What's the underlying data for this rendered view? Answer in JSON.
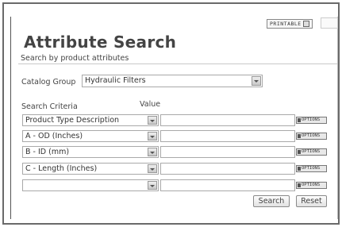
{
  "header": {
    "printable_label": "PRINTABLE"
  },
  "page": {
    "title": "Attribute Search",
    "subtitle": "Search by product attributes"
  },
  "catalog_group": {
    "label": "Catalog Group",
    "selected": "Hydraulic Filters"
  },
  "criteria": {
    "col_criteria": "Search Criteria",
    "col_value": "Value",
    "rows": [
      {
        "criteria": "Product Type Description",
        "value": "",
        "options_label": "OPTIONS"
      },
      {
        "criteria": "A - OD (Inches)",
        "value": "",
        "options_label": "OPTIONS"
      },
      {
        "criteria": "B - ID (mm)",
        "value": "",
        "options_label": "OPTIONS"
      },
      {
        "criteria": "C - Length (Inches)",
        "value": "",
        "options_label": "OPTIONS"
      },
      {
        "criteria": "",
        "value": "",
        "options_label": "OPTIONS"
      }
    ]
  },
  "actions": {
    "search_label": "Search",
    "reset_label": "Reset"
  }
}
